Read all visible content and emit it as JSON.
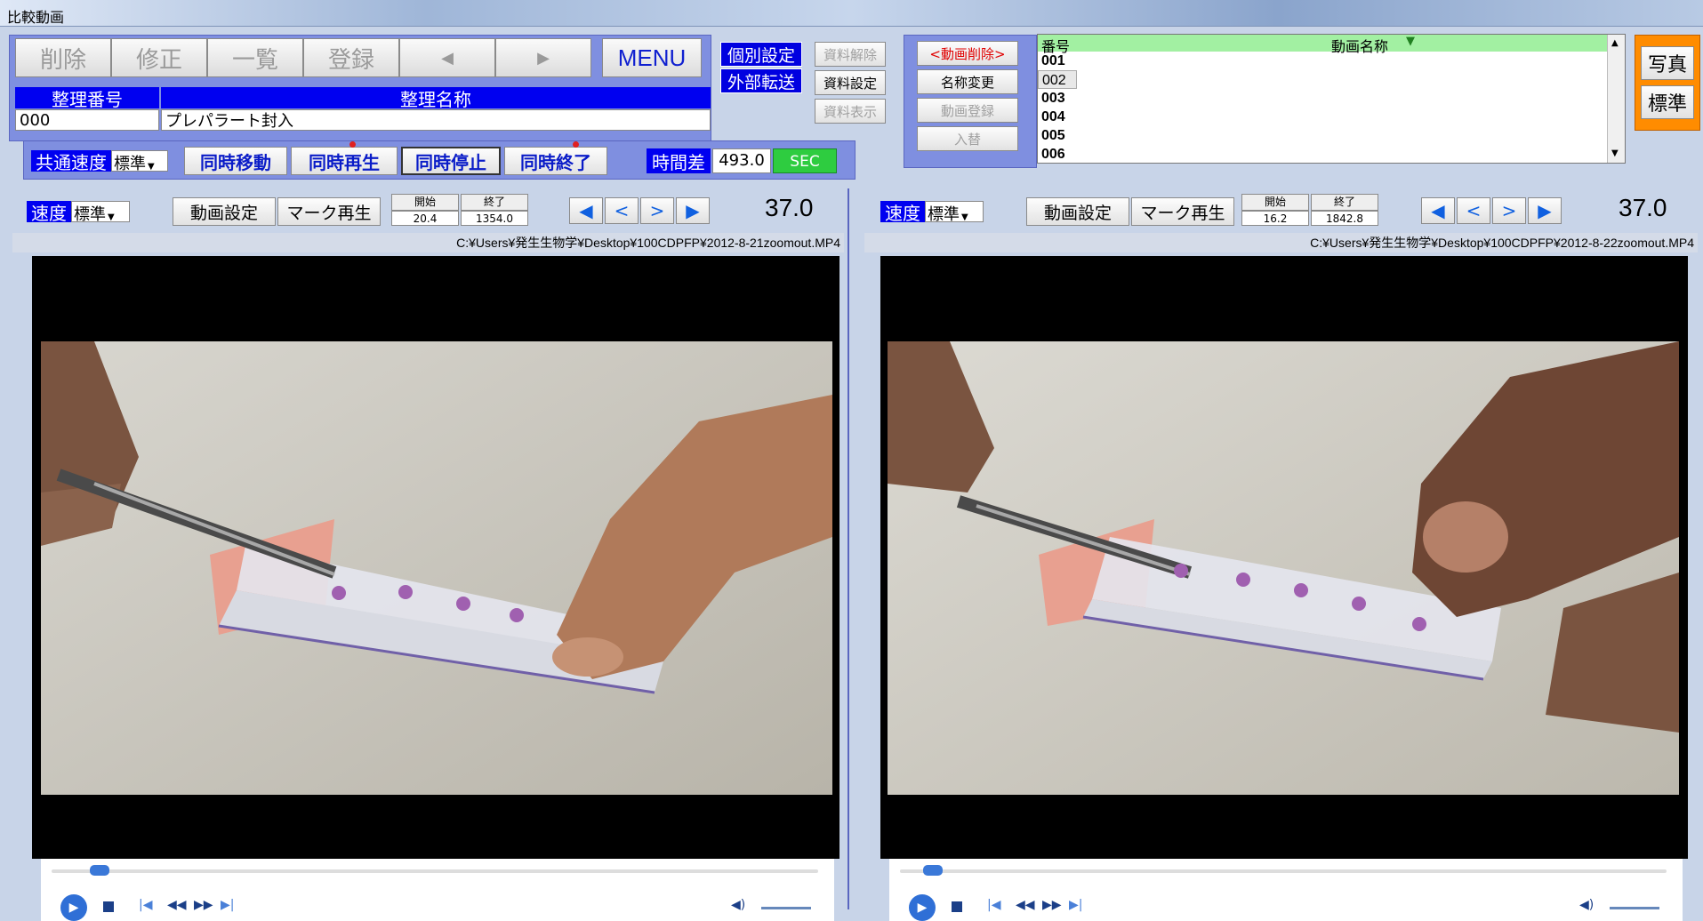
{
  "window": {
    "title": "比較動画"
  },
  "toolbar": {
    "delete": "削除",
    "modify": "修正",
    "list": "一覧",
    "register": "登録",
    "prev": "◀",
    "next": "▶",
    "menu": "MENU"
  },
  "record": {
    "number_header": "整理番号",
    "name_header": "整理名称",
    "number_value": "000",
    "name_value": "プレパラート封入"
  },
  "settings": {
    "individual": "個別設定",
    "external": "外部転送",
    "unlock": "資料解除",
    "set": "資料設定",
    "show": "資料表示"
  },
  "video_ops": {
    "delete": "<動画削除>",
    "rename": "名称変更",
    "register": "動画登録",
    "swap": "入替"
  },
  "video_list": {
    "col_number": "番号",
    "col_name": "動画名称",
    "sort_icon": "▼",
    "rows": [
      "001",
      "002",
      "003",
      "004",
      "005",
      "006"
    ],
    "selected_index": 1
  },
  "right_buttons": {
    "photo": "写真",
    "standard": "標準"
  },
  "sync": {
    "speed_label": "共通速度",
    "speed_value": "標準",
    "move": "同時移動",
    "play": "同時再生",
    "stop": "同時停止",
    "end": "同時終了",
    "diff_label": "時間差",
    "diff_value": "493.0",
    "unit": "SEC"
  },
  "left": {
    "speed_label": "速度",
    "speed_value": "標準",
    "video_settings": "動画設定",
    "mark_play": "マーク再生",
    "start_label": "開始",
    "end_label": "終了",
    "start_value": "20.4",
    "end_value": "1354.0",
    "time": "37.0",
    "path": "C:¥Users¥発生生物学¥Desktop¥100CDPFP¥2012-8-21zoomout.MP4",
    "seek_fraction": 0.05
  },
  "right": {
    "speed_label": "速度",
    "speed_value": "標準",
    "video_settings": "動画設定",
    "mark_play": "マーク再生",
    "start_label": "開始",
    "end_label": "終了",
    "start_value": "16.2",
    "end_value": "1842.8",
    "time": "37.0",
    "path": "C:¥Users¥発生生物学¥Desktop¥100CDPFP¥2012-8-22zoomout.MP4",
    "seek_fraction": 0.03
  },
  "nav": {
    "first": "◀",
    "back": "<",
    "fwd": ">",
    "last": "▶"
  },
  "colors": {
    "accent_blue": "#0000f0",
    "panel_purple": "#7f8fe0",
    "sec_green": "#2ecc40",
    "list_header": "#a2f0a2",
    "orange": "#ff8c00"
  }
}
